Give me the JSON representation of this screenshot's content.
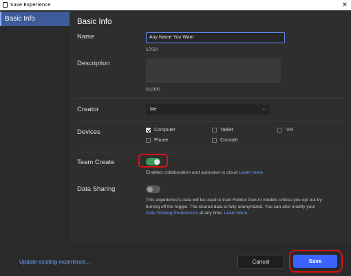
{
  "window": {
    "title": "Save Experience",
    "close_glyph": "✕"
  },
  "sidebar": {
    "items": [
      {
        "label": "Basic Info",
        "selected": true
      }
    ]
  },
  "main": {
    "heading": "Basic Info",
    "name": {
      "label": "Name",
      "value": "Any Name You Want",
      "counter": "17/50"
    },
    "description": {
      "label": "Description",
      "value": "",
      "counter": "0/1000"
    },
    "creator": {
      "label": "Creator",
      "value": "Me",
      "chevron": "⌄"
    },
    "devices": {
      "label": "Devices",
      "options": [
        {
          "label": "Computer",
          "checked": true
        },
        {
          "label": "Tablet",
          "checked": false
        },
        {
          "label": "VR",
          "checked": false
        },
        {
          "label": "Phone",
          "checked": false
        },
        {
          "label": "Console",
          "checked": false
        }
      ]
    },
    "team_create": {
      "label": "Team Create",
      "enabled": true,
      "help": "Enables collaboration and autosave to cloud",
      "link": "Learn more"
    },
    "data_sharing": {
      "label": "Data Sharing",
      "enabled": false,
      "help_line1": "This experience's data will be used to train Roblox Gen AI models unless you opt out by",
      "help_line2": "turning off the toggle. The shared data is fully anonymized. You can also modify your",
      "help_link_prefs": "Data Sharing Preferences",
      "help_mid": " at any time. ",
      "help_link_more": "Learn More"
    }
  },
  "footer": {
    "update_link": "Update existing experience...",
    "cancel_label": "Cancel",
    "save_label": "Save"
  },
  "colors": {
    "accent": "#3b63ff",
    "link": "#6f9fff",
    "toggle_on": "#3d9a56",
    "highlight_mark": "#e01010"
  }
}
